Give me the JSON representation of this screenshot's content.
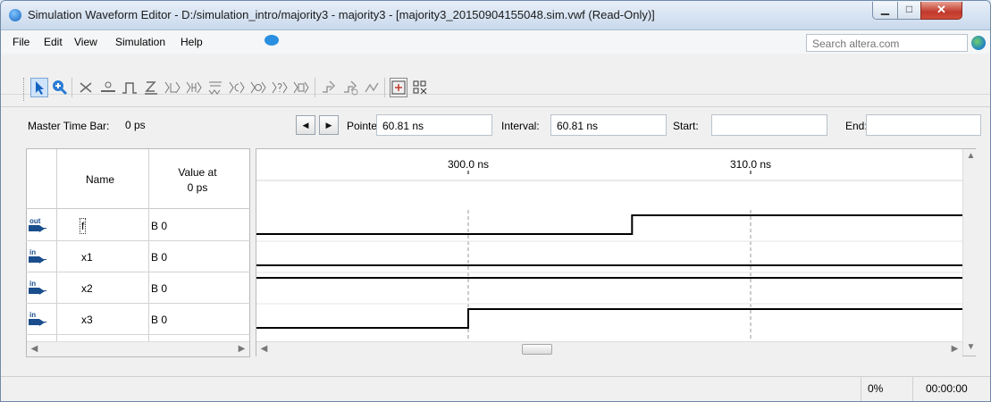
{
  "window": {
    "title": "Simulation Waveform Editor - D:/simulation_intro/majority3 - majority3 - [majority3_20150904155048.sim.vwf (Read-Only)]",
    "min_glyph": "▁",
    "max_glyph": "□",
    "close_glyph": "✕"
  },
  "menu": [
    "File",
    "Edit",
    "View",
    "Simulation",
    "Help"
  ],
  "search": {
    "placeholder": "Search altera.com"
  },
  "timebar": {
    "master_label": "Master Time Bar:",
    "master_value": "0 ps",
    "prev_glyph": "◀",
    "next_glyph": "▶",
    "pointer_label": "Pointer:",
    "pointer_value": "60.81 ns",
    "interval_label": "Interval:",
    "interval_value": "60.81 ns",
    "start_label": "Start:",
    "start_value": "",
    "end_label": "End:",
    "end_value": ""
  },
  "signals_table": {
    "col_name": "Name",
    "col_value_line1": "Value at",
    "col_value_line2": "0 ps",
    "rows": [
      {
        "dir": "out",
        "name": "f",
        "value": "B 0"
      },
      {
        "dir": "in",
        "name": "x1",
        "value": "B 0"
      },
      {
        "dir": "in",
        "name": "x2",
        "value": "B 0"
      },
      {
        "dir": "in",
        "name": "x3",
        "value": "B 0"
      }
    ]
  },
  "waveform": {
    "time_ticks": [
      {
        "label": "300.0 ns",
        "time_ns": 300
      },
      {
        "label": "310.0 ns",
        "time_ns": 310
      }
    ],
    "visible_range_ns": [
      292.5,
      317.5
    ],
    "signals": [
      {
        "name": "f",
        "initial": 0,
        "transitions_ns": [
          305.8
        ]
      },
      {
        "name": "x1",
        "initial": 0,
        "transitions_ns": []
      },
      {
        "name": "x2",
        "initial": 1,
        "transitions_ns": []
      },
      {
        "name": "x3",
        "initial": 0,
        "transitions_ns": [
          300.0
        ]
      }
    ],
    "colors": {
      "wave": "#000000",
      "gridline": "#9a9a9a"
    }
  },
  "status": {
    "progress": "0%",
    "elapsed": "00:00:00"
  }
}
